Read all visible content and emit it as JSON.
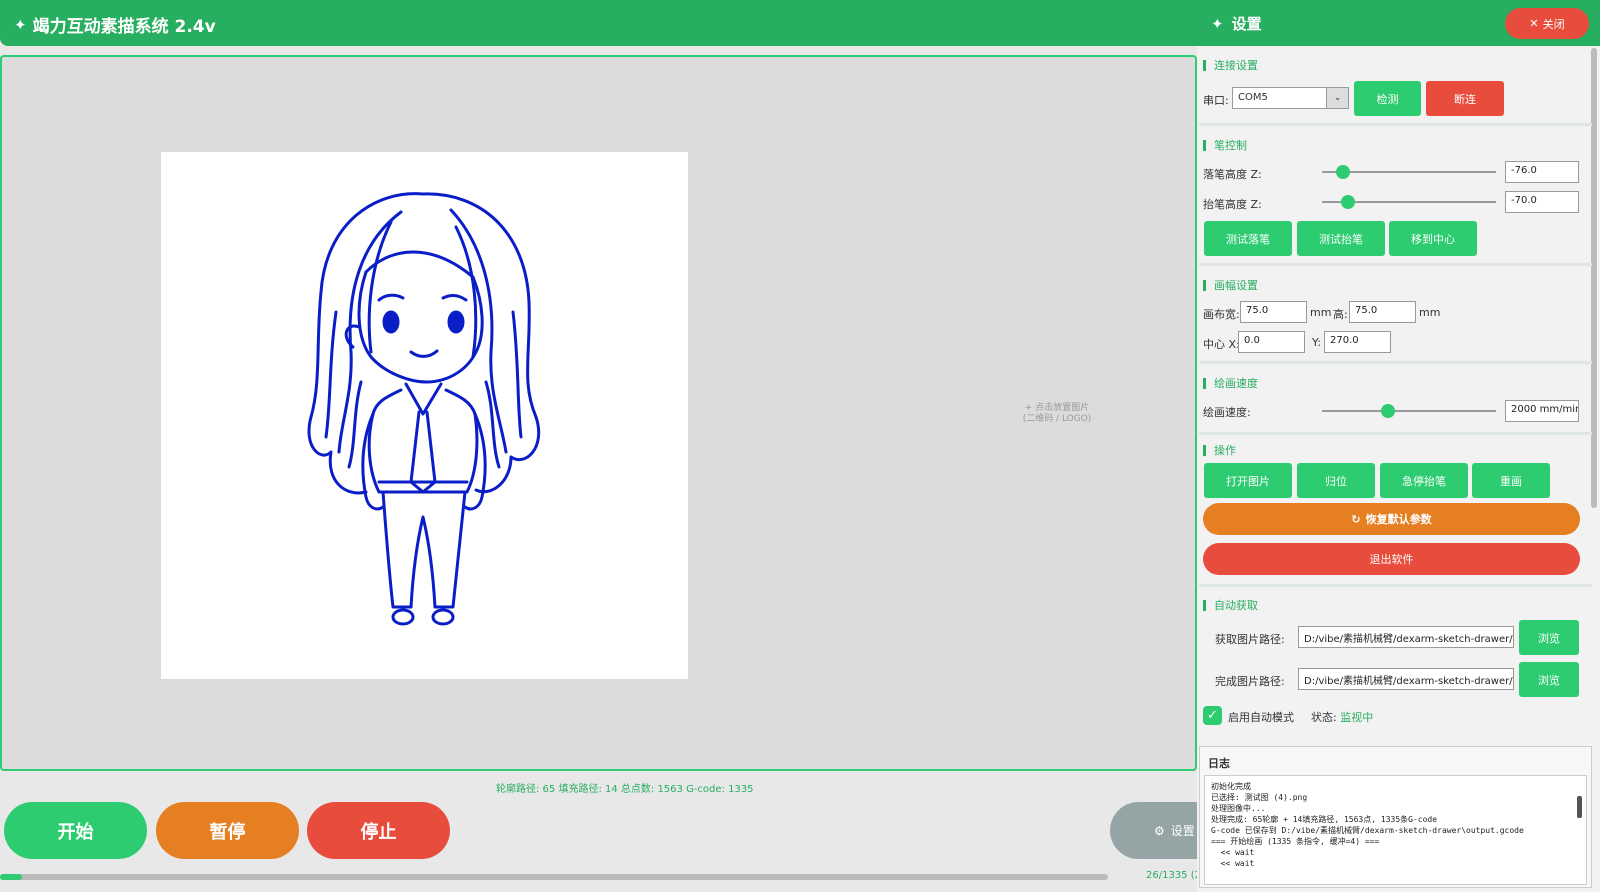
{
  "app": {
    "title": "竭力互动素描系统  2.4v"
  },
  "canvas": {
    "drop_hint_line1": "+ 点击放置图片",
    "drop_hint_line2": "(二维码 / LOGO)"
  },
  "stats": "轮廓路径: 65  填充路径: 14  总点数: 1563  G-code: 1335",
  "controls": {
    "start": "开始",
    "pause": "暂停",
    "stop": "停止",
    "settings": "设置"
  },
  "progress": {
    "fraction": 0.0195,
    "text": "26/1335 (2"
  },
  "settings": {
    "title": "设置",
    "close": "关闭",
    "connection": {
      "title": "连接设置",
      "port_label": "串口:",
      "port_value": "COM5",
      "detect": "检测",
      "disconnect": "断连"
    },
    "pen": {
      "title": "笔控制",
      "down_label": "落笔高度 Z:",
      "down_value": "-76.0",
      "down_level": 0.12,
      "up_label": "抬笔高度 Z:",
      "up_value": "-70.0",
      "up_level": 0.15,
      "test_down": "测试落笔",
      "test_up": "测试抬笔",
      "move_center": "移到中心"
    },
    "canvas_settings": {
      "title": "画幅设置",
      "width_label": "画布宽:",
      "width_value": "75.0",
      "unit": "mm",
      "height_label": "高:",
      "height_value": "75.0",
      "center_x_label": "中心 X:",
      "center_x_value": "0.0",
      "y_label": "Y:",
      "y_value": "270.0"
    },
    "speed": {
      "title": "绘画速度",
      "label": "绘画速度:",
      "value": "2000 mm/min",
      "level": 0.38
    },
    "operations": {
      "title": "操作",
      "open_image": "打开图片",
      "home": "归位",
      "emergency": "急停抬笔",
      "redraw": "重画",
      "restore_defaults": "恢复默认参数",
      "exit": "退出软件"
    },
    "auto": {
      "title": "自动获取",
      "fetch_label": "获取图片路径:",
      "fetch_path": "D:/vibe/素描机械臂/dexarm-sketch-drawer/",
      "done_label": "完成图片路径:",
      "done_path": "D:/vibe/素描机械臂/dexarm-sketch-drawer/",
      "browse": "浏览",
      "enable_label": "启用自动模式",
      "status_label": "状态:",
      "status_value": "监视中"
    },
    "log": {
      "title": "日志",
      "lines": [
        "初始化完成",
        "已选择: 测试图 (4).png",
        "处理图像中...",
        "处理完成: 65轮廓 + 14填充路径, 1563点, 1335条G-code",
        "G-code 已保存到 D:/vibe/素描机械臂/dexarm-sketch-drawer\\output.gcode",
        "",
        "=== 开始绘画 (1335 条指令, 缓冲=4) ===",
        "  << wait",
        "  << wait"
      ]
    }
  },
  "colors": {
    "accent": "#27ae60",
    "green": "#2ecc71",
    "orange": "#e67e22",
    "red": "#e74c3c",
    "sketch": "#0a1ec8"
  }
}
